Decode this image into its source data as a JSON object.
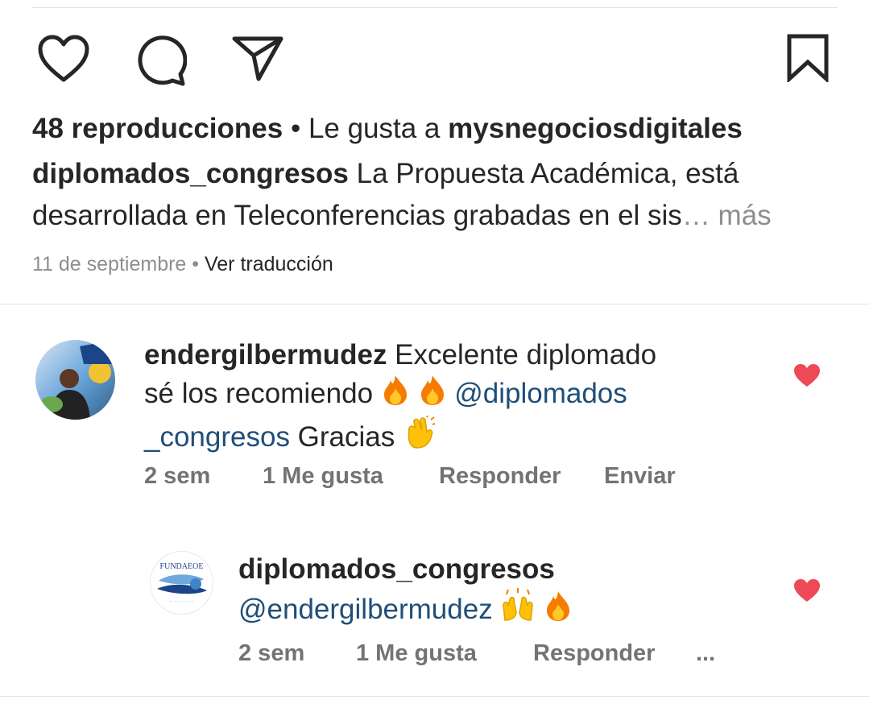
{
  "post": {
    "views": "48 reproducciones",
    "separator": " • ",
    "liked_prefix": "Le gusta a ",
    "liked_user": "mysnegociosdigitales",
    "caption_user": "diplomados_congresos",
    "caption_line1": " La Propuesta Académica, está",
    "caption_line2": "desarrollada en Teleconferencias grabadas en el sis",
    "ellipsis": "…",
    "more": " más",
    "date": "11 de septiembre",
    "dot": " • ",
    "translate": "Ver traducción"
  },
  "icons": {
    "like": "heart-outline-icon",
    "comment": "speech-bubble-icon",
    "share": "paper-plane-icon",
    "save": "bookmark-icon",
    "comment_like": "heart-filled-icon"
  },
  "colors": {
    "heart": "#ed4956",
    "mention": "#1f4e79",
    "muted": "#8e8e8e"
  },
  "comments": [
    {
      "user": "endergilbermudez",
      "text1": " Excelente diplomado",
      "text2": "sé los recomiendo ",
      "mention_part1": "@diplomados",
      "mention_part2": "_congresos",
      "text3": " Gracias ",
      "time": "2 sem",
      "likes": "1 Me gusta",
      "reply": "Responder",
      "send": "Enviar"
    },
    {
      "user": "diplomados_congresos",
      "mention": "@endergilbermudez",
      "time": "2 sem",
      "likes": "1 Me gusta",
      "reply": "Responder",
      "more": "..."
    }
  ]
}
